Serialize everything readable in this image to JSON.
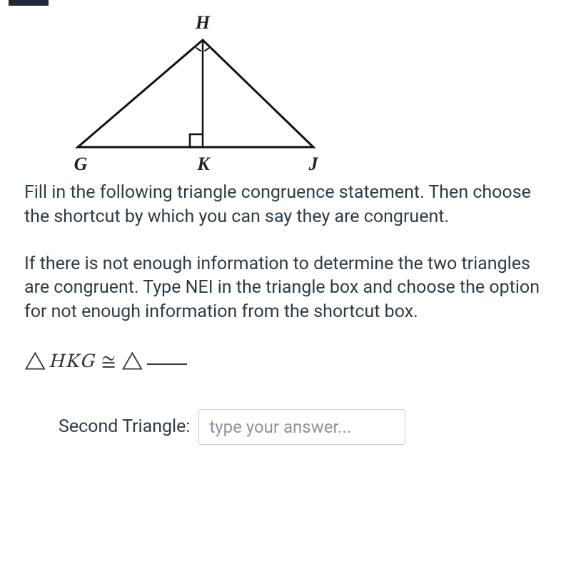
{
  "figure": {
    "vertices": {
      "top": "H",
      "bottom_left": "G",
      "bottom_middle": "K",
      "bottom_right": "J"
    }
  },
  "instructions": {
    "paragraph1": "Fill in the following triangle congruence statement. Then choose the shortcut by which you can say they are congruent.",
    "paragraph2": "If there is not enough information to determine the two triangles are congruent. Type NEI in the triangle box and choose the option for not enough information from the shortcut box."
  },
  "math": {
    "triangle_symbol": "△",
    "given_triangle": "HKG",
    "congruent_symbol": "≅"
  },
  "answer": {
    "label": "Second Triangle:",
    "placeholder": "type your answer..."
  }
}
